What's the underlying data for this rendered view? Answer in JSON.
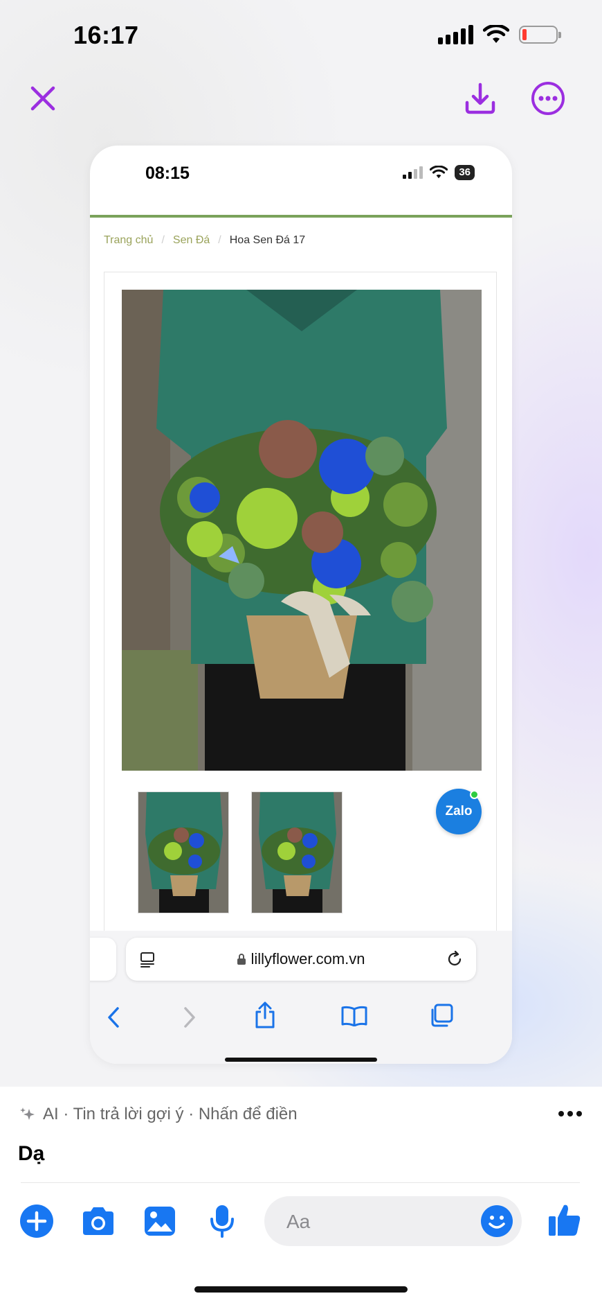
{
  "status_bar": {
    "time": "16:17"
  },
  "colors": {
    "accent": "#9b2ee0",
    "messenger_blue": "#1877f2",
    "breadcrumb_green": "#9aa35b",
    "zalo_blue": "#1b7fe0"
  },
  "top_actions": {
    "close_icon": "close-icon",
    "download_icon": "download-icon",
    "more_icon": "more-icon"
  },
  "screenshot": {
    "status_bar": {
      "time": "08:15",
      "battery": "36"
    },
    "breadcrumb": {
      "home": "Trang chủ",
      "category": "Sen Đá",
      "current": "Hoa Sen Đá 17"
    },
    "zalo_label": "Zalo",
    "safari": {
      "url": "lillyflower.com.vn"
    }
  },
  "messenger": {
    "suggestion_label": "AI · Tin trả lời gợi ý · Nhấn để điền",
    "suggestion_text": "Dạ",
    "composer_placeholder": "Aa"
  }
}
